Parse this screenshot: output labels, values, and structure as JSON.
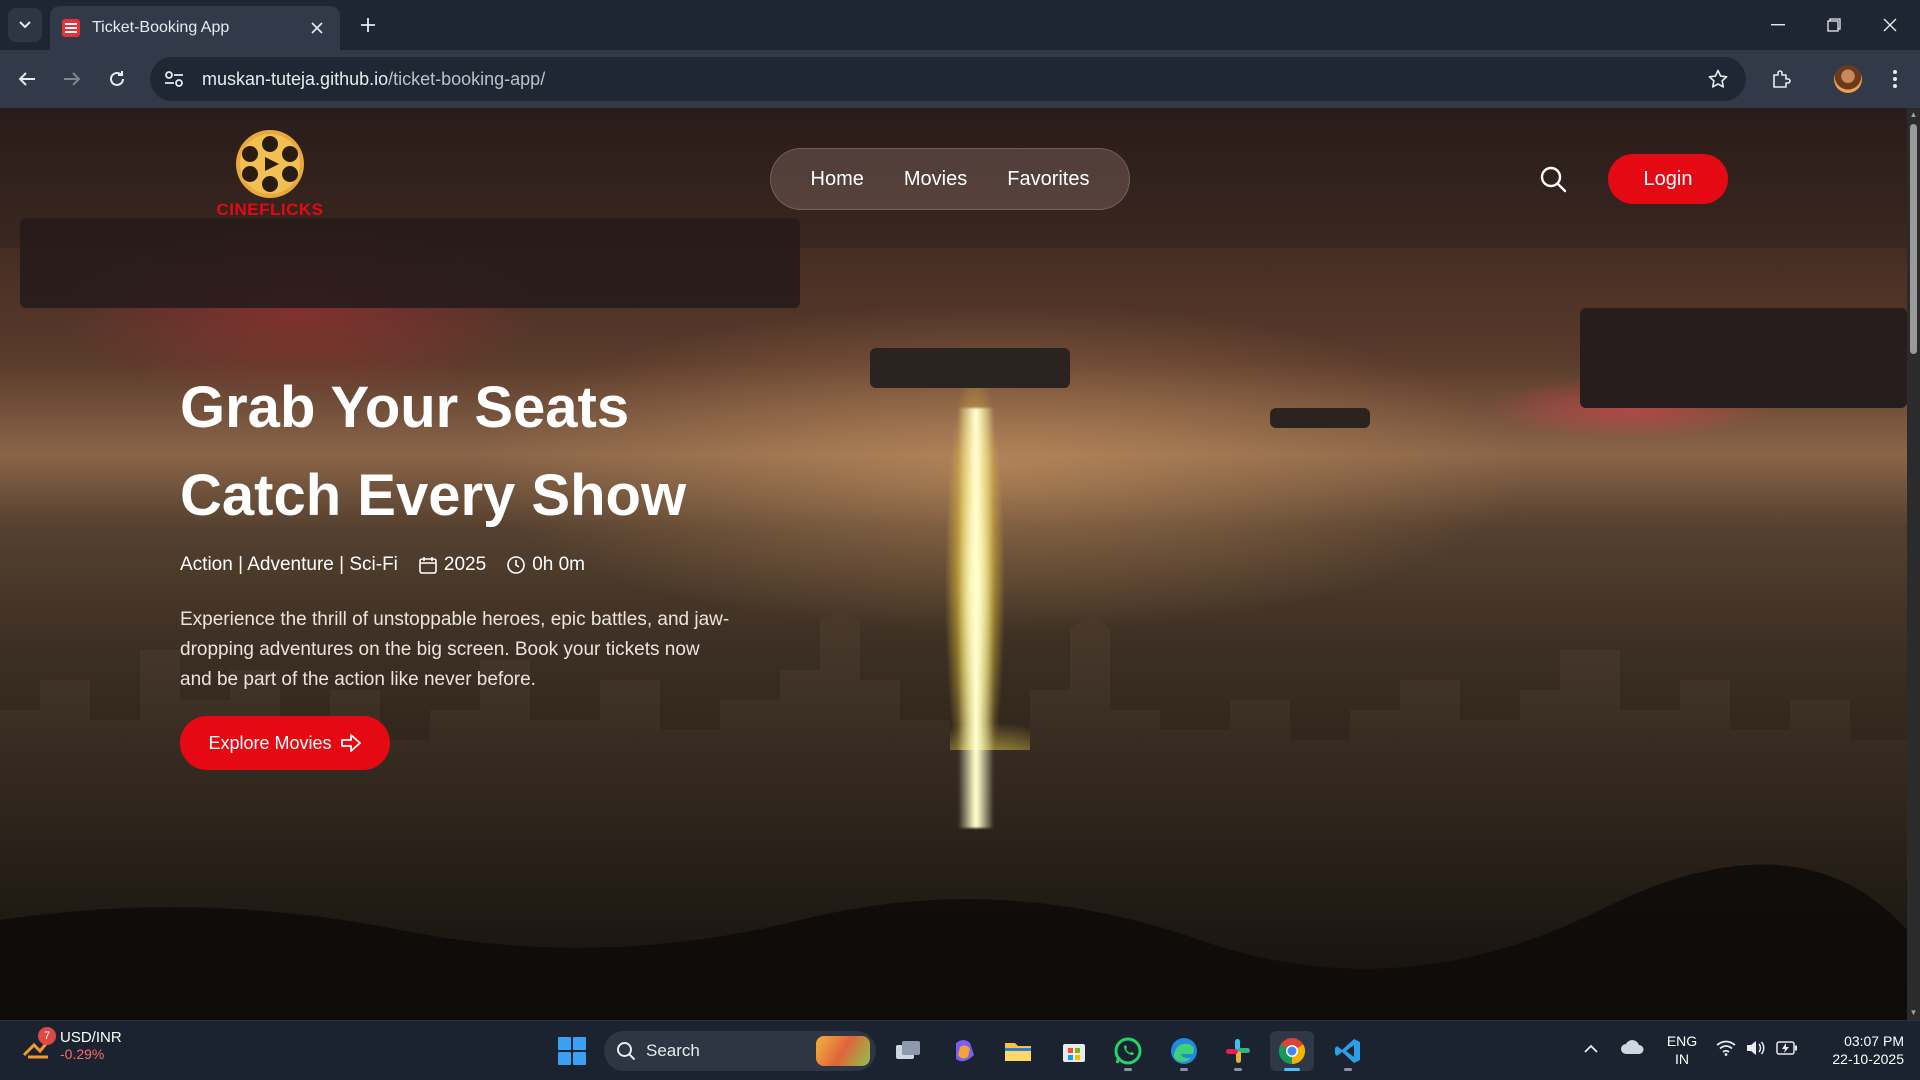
{
  "browser": {
    "tab_title": "Ticket-Booking App",
    "url_host": "muskan-tuteja.github.io",
    "url_path": "/ticket-booking-app/"
  },
  "site": {
    "logo_text": "CINEFLICKS",
    "nav": [
      "Home",
      "Movies",
      "Favorites"
    ],
    "login_label": "Login"
  },
  "hero": {
    "title_line1": "Grab Your Seats",
    "title_line2": "Catch Every Show",
    "genres": "Action | Adventure | Sci-Fi",
    "year": "2025",
    "duration": "0h 0m",
    "description": "Experience the thrill of unstoppable heroes, epic battles, and jaw-dropping adventures on the big screen. Book your tickets now and be part of the action like never before.",
    "cta_label": "Explore Movies"
  },
  "colors": {
    "accent": "#e50914",
    "chrome_bg": "#1f2633",
    "taskbar_bg": "#1c2330"
  },
  "taskbar": {
    "widget_badge": "7",
    "widget_title": "USD/INR",
    "widget_change": "-0.29%",
    "search_label": "Search",
    "apps": [
      "task-view-icon",
      "copilot-icon",
      "file-explorer-icon",
      "microsoft-store-icon",
      "whatsapp-icon",
      "edge-icon",
      "slack-icon",
      "chrome-icon",
      "vscode-icon"
    ],
    "language_line1": "ENG",
    "language_line2": "IN",
    "time": "03:07 PM",
    "date": "22-10-2025"
  }
}
